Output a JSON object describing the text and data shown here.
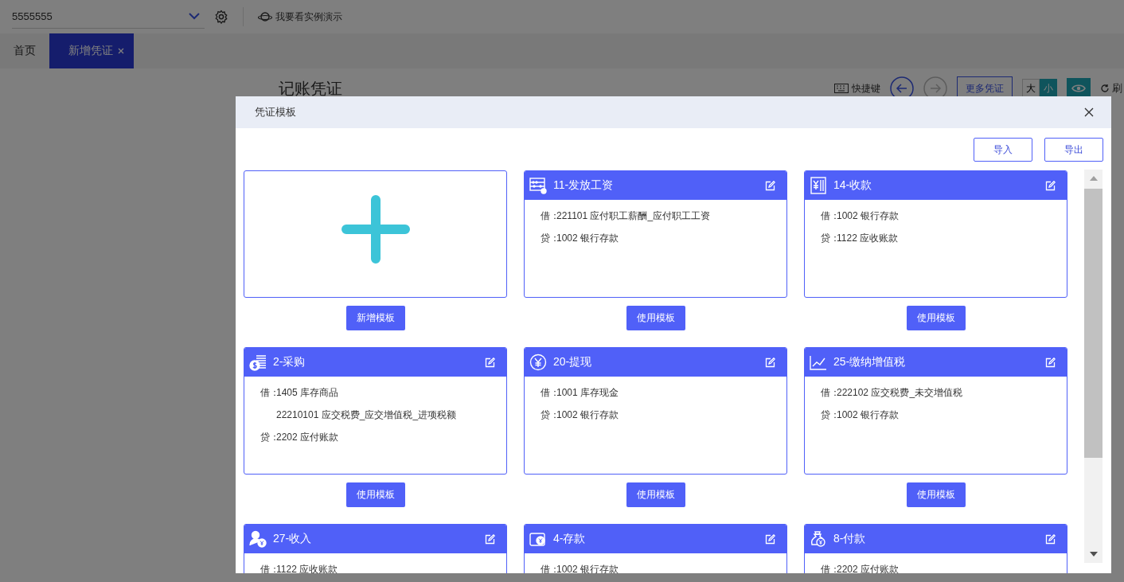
{
  "top_bar": {
    "account": "5555555",
    "demo_link": "我要看实例演示"
  },
  "tabs": [
    {
      "label": "首页",
      "selected": false,
      "closable": false
    },
    {
      "label": "新增凭证",
      "selected": true,
      "closable": true
    }
  ],
  "page": {
    "title": "记账凭证",
    "shortcut": "快捷键",
    "more_button": "更多凭证",
    "size_options": [
      {
        "label": "大",
        "selected": false
      },
      {
        "label": "小",
        "selected": true
      }
    ],
    "refresh": "刷"
  },
  "dialog": {
    "title": "凭证模板",
    "actions": [
      "导入",
      "导出"
    ],
    "new_template_button": "新增模板",
    "templates": [
      {
        "name": "11-发放工资",
        "kind": "abacus",
        "lines": [
          {
            "side": "借：",
            "account": "221101 应付职工薪酬_应付职工工资"
          },
          {
            "side": "贷：",
            "account": "1002 银行存款"
          }
        ],
        "button": "使用模板"
      },
      {
        "name": "14-收款",
        "kind": "yen-book",
        "lines": [
          {
            "side": "借：",
            "account": "1002 银行存款"
          },
          {
            "side": "贷：",
            "account": "1122 应收账款"
          }
        ],
        "button": "使用模板"
      },
      {
        "name": "2-采购",
        "kind": "money-list",
        "lines": [
          {
            "side": "借：",
            "account": "1405 库存商品"
          },
          {
            "account": "22210101 应交税费_应交增值税_进项税额"
          },
          {
            "side": "贷：",
            "account": "2202 应付账款"
          }
        ],
        "button": "使用模板"
      },
      {
        "name": "20-提现",
        "kind": "yen-circle",
        "lines": [
          {
            "side": "借：",
            "account": "1001 库存现金"
          },
          {
            "side": "贷：",
            "account": "1002 银行存款"
          }
        ],
        "button": "使用模板"
      },
      {
        "name": "25-缴纳增值税",
        "kind": "chart",
        "lines": [
          {
            "side": "借：",
            "account": "222102 应交税费_未交增值税"
          },
          {
            "side": "贷：",
            "account": "1002 银行存款"
          }
        ],
        "button": "使用模板"
      },
      {
        "name": "27-收入",
        "kind": "person-yen",
        "lines": [
          {
            "side": "借：",
            "account": "1122 应收账款"
          }
        ]
      },
      {
        "name": "4-存款",
        "kind": "wallet-yen",
        "lines": [
          {
            "side": "借：",
            "account": "1002 银行存款"
          }
        ]
      },
      {
        "name": "8-付款",
        "kind": "bag-yen",
        "lines": [
          {
            "side": "借：",
            "account": "2202 应付账款"
          }
        ]
      }
    ]
  }
}
